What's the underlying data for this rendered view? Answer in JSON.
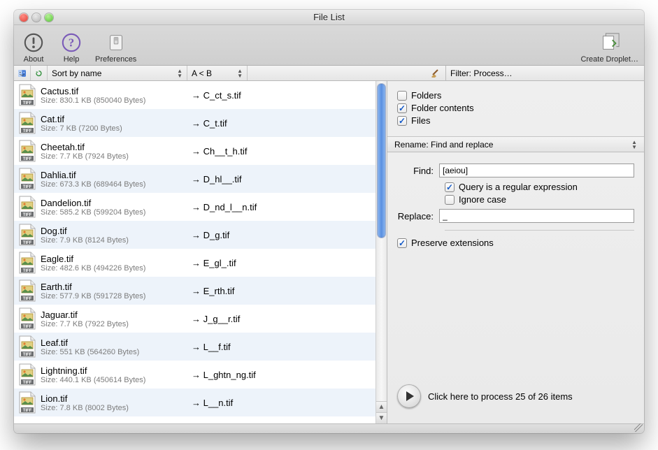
{
  "window": {
    "title": "File List"
  },
  "toolbar": {
    "about": "About",
    "help": "Help",
    "preferences": "Preferences",
    "create_droplet": "Create Droplet…"
  },
  "subbar": {
    "sort_label": "Sort by name",
    "ab_label": "A < B"
  },
  "files": [
    {
      "name": "Cactus.tif",
      "size": "Size: 830.1 KB (850040 Bytes)",
      "target": "→ C_ct_s.tif"
    },
    {
      "name": "Cat.tif",
      "size": "Size: 7 KB (7200 Bytes)",
      "target": "→ C_t.tif"
    },
    {
      "name": "Cheetah.tif",
      "size": "Size: 7.7 KB (7924 Bytes)",
      "target": "→ Ch__t_h.tif"
    },
    {
      "name": "Dahlia.tif",
      "size": "Size: 673.3 KB (689464 Bytes)",
      "target": "→ D_hl__.tif"
    },
    {
      "name": "Dandelion.tif",
      "size": "Size: 585.2 KB (599204 Bytes)",
      "target": "→ D_nd_l__n.tif"
    },
    {
      "name": "Dog.tif",
      "size": "Size: 7.9 KB (8124 Bytes)",
      "target": "→ D_g.tif"
    },
    {
      "name": "Eagle.tif",
      "size": "Size: 482.6 KB (494226 Bytes)",
      "target": "→ E_gl_.tif"
    },
    {
      "name": "Earth.tif",
      "size": "Size: 577.9 KB (591728 Bytes)",
      "target": "→ E_rth.tif"
    },
    {
      "name": "Jaguar.tif",
      "size": "Size: 7.7 KB (7922 Bytes)",
      "target": "→ J_g__r.tif"
    },
    {
      "name": "Leaf.tif",
      "size": "Size: 551 KB (564260 Bytes)",
      "target": "→ L__f.tif"
    },
    {
      "name": "Lightning.tif",
      "size": "Size: 440.1 KB (450614 Bytes)",
      "target": "→ L_ghtn_ng.tif"
    },
    {
      "name": "Lion.tif",
      "size": "Size: 7.8 KB (8002 Bytes)",
      "target": "→ L__n.tif"
    }
  ],
  "filter": {
    "header": "Filter: Process…",
    "folders": "Folders",
    "folder_contents": "Folder contents",
    "files": "Files"
  },
  "rename": {
    "header": "Rename: Find and replace",
    "find_label": "Find:",
    "find_value": "[aeiou]",
    "regex": "Query is a regular expression",
    "ignore_case": "Ignore case",
    "replace_label": "Replace:",
    "replace_value": "_",
    "preserve": "Preserve extensions"
  },
  "process": {
    "label": "Click here to process 25 of 26 items"
  }
}
